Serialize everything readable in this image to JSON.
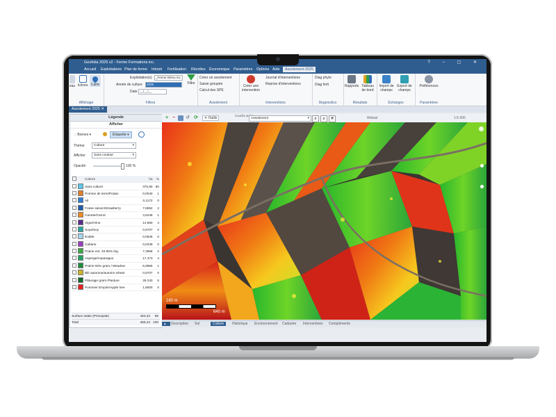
{
  "window": {
    "title": "Geofolia 2025 v2 - Ferme Formations inc."
  },
  "menu": [
    "Accueil",
    "Exploitations",
    "Plan de ferme",
    "Intrant",
    "Fertilisation",
    "Récoltes",
    "Économique",
    "Paramètres",
    "Options",
    "Aide",
    "Assolement 2025"
  ],
  "ribbon": {
    "affichage": {
      "label": "Affichage",
      "icons_label": "Icônes",
      "carte_label": "Carte",
      "tableau_label": "eau"
    },
    "filtres": {
      "label": "Filtres",
      "exploitation_label": "Exploitation(s)",
      "exploitation_value": "_Ferme Démo inc.",
      "annee_label": "Année de culture",
      "annee_value": "2025",
      "date_label": "Date",
      "date_value": "__/__/__",
      "filtre_label": "Filtre"
    },
    "assolement": {
      "label": "Assolement",
      "items": [
        "Créer un assolement",
        "Saisie groupée",
        "Calcul des SPE"
      ]
    },
    "interventions": {
      "label": "Interventions",
      "create_label": "Créer une intervention",
      "items": [
        "Journal d'interventions",
        "Reprise d'interventions"
      ]
    },
    "diagnostics": {
      "label": "Diagnostics",
      "items": [
        "Diag phyto",
        "Diag ferti"
      ]
    },
    "resultats": {
      "label": "Résultats",
      "rapports_label": "Rapports",
      "tableau_label": "Tableau de bord"
    },
    "echanges": {
      "label": "Échanges",
      "import_label": "Import de champs",
      "export_label": "Export de champs"
    },
    "parametres": {
      "label": "Paramètres",
      "pref_label": "Préférences"
    }
  },
  "doc_tab": "Assolement 2025",
  "legend": {
    "title": "Légende",
    "subtitle": "Afficher",
    "bornes_label": "Bornes",
    "etiquette_label": "Étiquette",
    "theme_label": "Thème",
    "theme_value": "Culture",
    "afficher_label": "Afficher",
    "afficher_value": "Sans couleur",
    "opacite_label": "Opacité",
    "opacite_value": "100 %",
    "col_culture": "Culture",
    "col_ha": "ha",
    "col_pct": "%",
    "rows": [
      {
        "name": "Sans culture",
        "ha": "375,80",
        "pct": "80",
        "color": "#5bc8e8"
      },
      {
        "name": "Pomme de terre/Potato",
        "ha": "0,0040",
        "pct": "1",
        "color": "#e07f2a"
      },
      {
        "name": "Ail",
        "ha": "0,1172",
        "pct": "0",
        "color": "#2c7fd3"
      },
      {
        "name": "Fraise saison/Strawberry",
        "ha": "7,6552",
        "pct": "2",
        "color": "#1f5aa8"
      },
      {
        "name": "Carotte/Carrot",
        "ha": "3,5249",
        "pct": "1",
        "color": "#f08a24"
      },
      {
        "name": "Vigne/Vine",
        "ha": "14,960",
        "pct": "3",
        "color": "#5a2e8a"
      },
      {
        "name": "Soya/Soy",
        "ha": "0,9707",
        "pct": "0",
        "color": "#2aa7a0"
      },
      {
        "name": "Érable",
        "ha": "0,0846",
        "pct": "0",
        "color": "#a8d8f0"
      },
      {
        "name": "Cabane",
        "ha": "0,0339",
        "pct": "0",
        "color": "#9b3fc2"
      },
      {
        "name": "Prairie ent. 40-80% lég.",
        "ha": "7,3958",
        "pct": "2",
        "color": "#3da845"
      },
      {
        "name": "Asperge/Asparagus",
        "ha": "17,473",
        "pct": "4",
        "color": "#26a060"
      },
      {
        "name": "Prairie 60% gram./ Meadow",
        "ha": "6,9966",
        "pct": "1",
        "color": "#1d8f3c"
      },
      {
        "name": "Blé automne/autumn wheat",
        "ha": "0,5707",
        "pct": "0",
        "color": "#c9b32a"
      },
      {
        "name": "Pâturage gram./Pasture",
        "ha": "26,343",
        "pct": "6",
        "color": "#0f6a2e"
      },
      {
        "name": "Pommier Empire/Apple tree",
        "ha": "1,8000",
        "pct": "0",
        "color": "#e82020"
      }
    ],
    "surface_label": "Surface totale (Principale)",
    "surface_ha": "463,43",
    "surface_pct": "99",
    "total_label": "Total",
    "total_ha": "465,44",
    "total_pct": "100"
  },
  "map": {
    "couche_label": "Couche active",
    "couche_value": "Assolement",
    "outils_label": "Outils",
    "coord_text": "Webair",
    "scale_top": "160 m",
    "scale_bottom": "640 m",
    "zoom_text": "1:5 000"
  },
  "bottom_tabs": [
    "Description",
    "Sol",
    "Culture",
    "Historique",
    "Environnement",
    "Cadastre",
    "Interventions",
    "Compléments"
  ],
  "active_bottom_tab": "Culture"
}
